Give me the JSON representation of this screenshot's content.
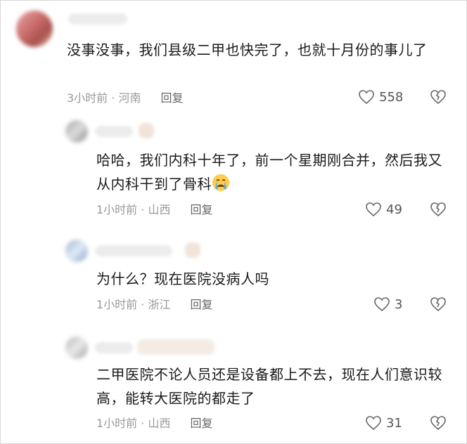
{
  "comments": [
    {
      "text": "没事没事，我们县级二甲也快完了，也就十月份的事儿了",
      "time": "3小时前",
      "location": "河南",
      "reply_label": "回复",
      "likes": "558",
      "avatar_colors": [
        "#d98a8a",
        "#c97070",
        "#e8b0a0"
      ]
    },
    {
      "text": "哈哈，我们内科十年了，前一个星期刚合并，然后我又从内科干到了骨科",
      "emoji": "crying-face-icon",
      "time": "1小时前",
      "location": "山西",
      "reply_label": "回复",
      "likes": "49",
      "avatar_colors": [
        "#c8c8c8",
        "#e0e0e0",
        "#a0a0a0"
      ]
    },
    {
      "text": "为什么？现在医院没病人吗",
      "time": "1小时前",
      "location": "浙江",
      "reply_label": "回复",
      "likes": "3",
      "avatar_colors": [
        "#b8c8e0",
        "#d0dff0",
        "#9fb4d0"
      ]
    },
    {
      "text": "二甲医院不论人员还是设备都上不去，现在人们意识较高，能转大医院的都走了",
      "time": "1小时前",
      "location": "山西",
      "reply_label": "回复",
      "likes": "31",
      "avatar_colors": [
        "#d0d0d0",
        "#e6e6e6",
        "#b5b5b5"
      ]
    }
  ],
  "meta_separator": " · "
}
